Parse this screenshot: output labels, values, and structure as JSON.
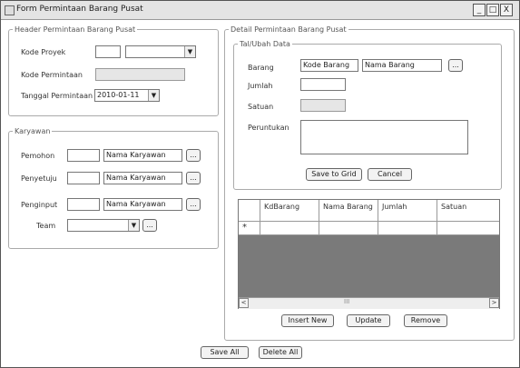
{
  "window": {
    "title": "Form Permintaan Barang Pusat",
    "minimize": "_",
    "maximize": "□",
    "close": "X"
  },
  "header": {
    "legend": "Header Permintaan Barang Pusat",
    "kode_proyek_label": "Kode Proyek",
    "kode_permintaan_label": "Kode Permintaan",
    "tanggal_label": "Tanggal Permintaan",
    "tanggal_value": "2010-01-11"
  },
  "karyawan": {
    "legend": "Karyawan",
    "pemohon_label": "Pemohon",
    "pemohon_name": "Nama Karyawan",
    "penyetuju_label": "Penyetuju",
    "penyetuju_name": "Nama Karyawan",
    "penginput_label": "Penginput",
    "penginput_name": "Nama Karyawan",
    "team_label": "Team",
    "browse": "..."
  },
  "detail": {
    "legend": "Detail Permintaan Barang Pusat",
    "sub_legend": "Tal/Ubah Data",
    "barang_label": "Barang",
    "kode_barang": "Kode Barang",
    "nama_barang": "Nama Barang",
    "browse": "...",
    "jumlah_label": "Jumlah",
    "satuan_label": "Satuan",
    "peruntukan_label": "Peruntukan",
    "save_grid": "Save to Grid",
    "cancel": "Cancel"
  },
  "grid": {
    "columns": [
      "KdBarang",
      "Nama Barang",
      "Jumlah",
      "Satuan"
    ],
    "new_row_marker": "*",
    "scroll_left": "<",
    "scroll_right": ">",
    "scroll_thumb": "III"
  },
  "grid_buttons": {
    "insert": "Insert New",
    "update": "Update",
    "remove": "Remove"
  },
  "footer": {
    "save_all": "Save All",
    "delete_all": "Delete All"
  }
}
